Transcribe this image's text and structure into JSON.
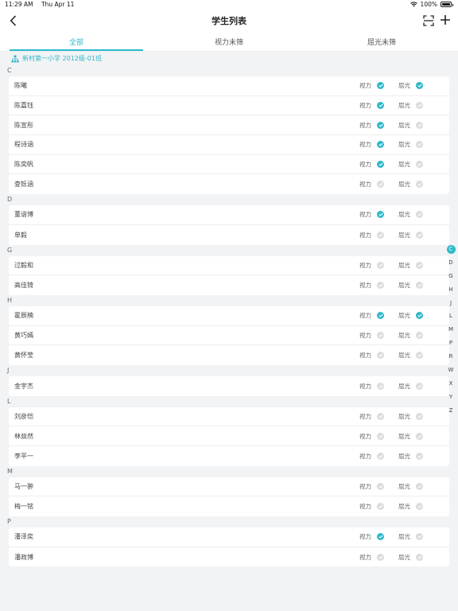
{
  "status": {
    "time": "11:29 AM",
    "date": "Thu Apr 11",
    "battery": "100%"
  },
  "nav": {
    "title": "学生列表"
  },
  "tabs": [
    {
      "label": "全部",
      "active": true
    },
    {
      "label": "视力未筛",
      "active": false
    },
    {
      "label": "屈光未筛",
      "active": false
    }
  ],
  "class_name": "新村第一小学 2012级-01班",
  "labels": {
    "vision": "视力",
    "refraction": "屈光"
  },
  "accent_color": "#2fb8c9",
  "sections": [
    {
      "letter": "C",
      "students": [
        {
          "name": "陈曦",
          "vision": true,
          "refraction": true
        },
        {
          "name": "陈嘉钰",
          "vision": true,
          "refraction": false
        },
        {
          "name": "陈宣彤",
          "vision": true,
          "refraction": false
        },
        {
          "name": "程诗涵",
          "vision": true,
          "refraction": false
        },
        {
          "name": "陈奕帆",
          "vision": true,
          "refraction": false
        },
        {
          "name": "查铄涵",
          "vision": false,
          "refraction": false
        }
      ]
    },
    {
      "letter": "D",
      "students": [
        {
          "name": "董谙博",
          "vision": true,
          "refraction": false
        },
        {
          "name": "单毅",
          "vision": false,
          "refraction": false
        }
      ]
    },
    {
      "letter": "G",
      "students": [
        {
          "name": "过毅和",
          "vision": false,
          "refraction": false
        },
        {
          "name": "高佳锜",
          "vision": false,
          "refraction": false
        }
      ]
    },
    {
      "letter": "H",
      "students": [
        {
          "name": "霍辰楠",
          "vision": true,
          "refraction": true
        },
        {
          "name": "黄巧嫣",
          "vision": false,
          "refraction": false
        },
        {
          "name": "黄怀莹",
          "vision": false,
          "refraction": false
        }
      ]
    },
    {
      "letter": "J",
      "students": [
        {
          "name": "金宇杰",
          "vision": false,
          "refraction": false
        }
      ]
    },
    {
      "letter": "L",
      "students": [
        {
          "name": "刘彦恺",
          "vision": false,
          "refraction": false
        },
        {
          "name": "林燚然",
          "vision": false,
          "refraction": false
        },
        {
          "name": "李平一",
          "vision": false,
          "refraction": false
        }
      ]
    },
    {
      "letter": "M",
      "students": [
        {
          "name": "马一翀",
          "vision": false,
          "refraction": false
        },
        {
          "name": "梅一铭",
          "vision": false,
          "refraction": false
        }
      ]
    },
    {
      "letter": "P",
      "students": [
        {
          "name": "潘泽奕",
          "vision": true,
          "refraction": false
        },
        {
          "name": "潘政博",
          "vision": false,
          "refraction": false
        }
      ]
    }
  ],
  "index_letters": [
    "C",
    "D",
    "G",
    "H",
    "J",
    "L",
    "M",
    "P",
    "R",
    "W",
    "X",
    "Y",
    "Z"
  ],
  "index_active": "C"
}
